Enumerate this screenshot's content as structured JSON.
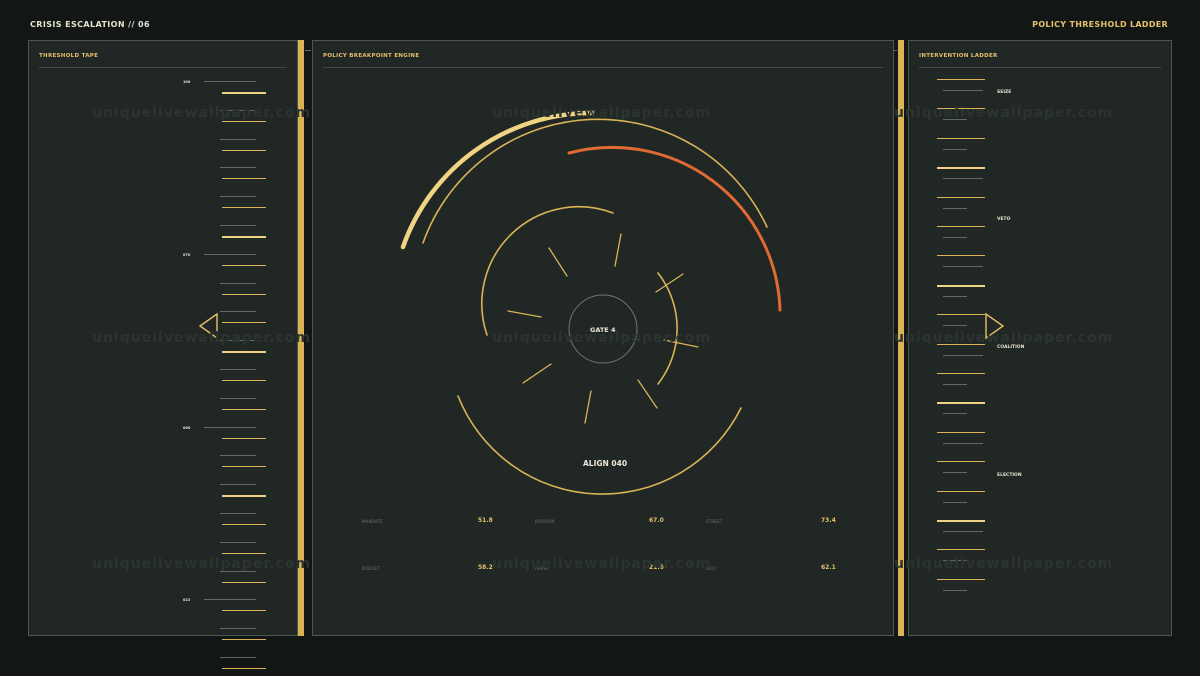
{
  "header": {
    "title": "CRISIS ESCALATION // 06",
    "right_title": "POLICY THRESHOLD LADDER"
  },
  "watermark": "uniquelivewallpaper.com",
  "left_panel": {
    "title": "THRESHOLD TAPE",
    "tape_numbers": [
      "100",
      "",
      "",
      "",
      "",
      "",
      "070",
      "",
      "",
      "",
      "",
      "",
      "000",
      "",
      "",
      "",
      "",
      "",
      "022",
      "",
      ""
    ],
    "arrow_icon": "triangle-left-icon"
  },
  "center_panel": {
    "title": "POLICY BREAKPOINT ENGINE",
    "gate_label": "GATE 4",
    "align_label": "ALIGN 040",
    "metrics": [
      {
        "label": "MANDATE",
        "value": "51.8"
      },
      {
        "label": "BORROW",
        "value": "67.0"
      },
      {
        "label": "STREET",
        "value": "73.4"
      },
      {
        "label": "BUDGET",
        "value": "58.2"
      },
      {
        "label": "PRESS",
        "value": "21.6"
      },
      {
        "label": "ALLY",
        "value": "62.1"
      }
    ]
  },
  "right_panel": {
    "title": "INTERVENTION LADDER",
    "labels": [
      "SEIZE",
      "VETO",
      "COALITION",
      "ELECTION"
    ],
    "arrow_icon": "triangle-right-icon"
  },
  "colors": {
    "background": "#121716",
    "panel": "#212724",
    "gold": "#e7c06a",
    "pale_gold": "#f1d384",
    "orange": "#e06a34",
    "rail": "#d9b356"
  }
}
